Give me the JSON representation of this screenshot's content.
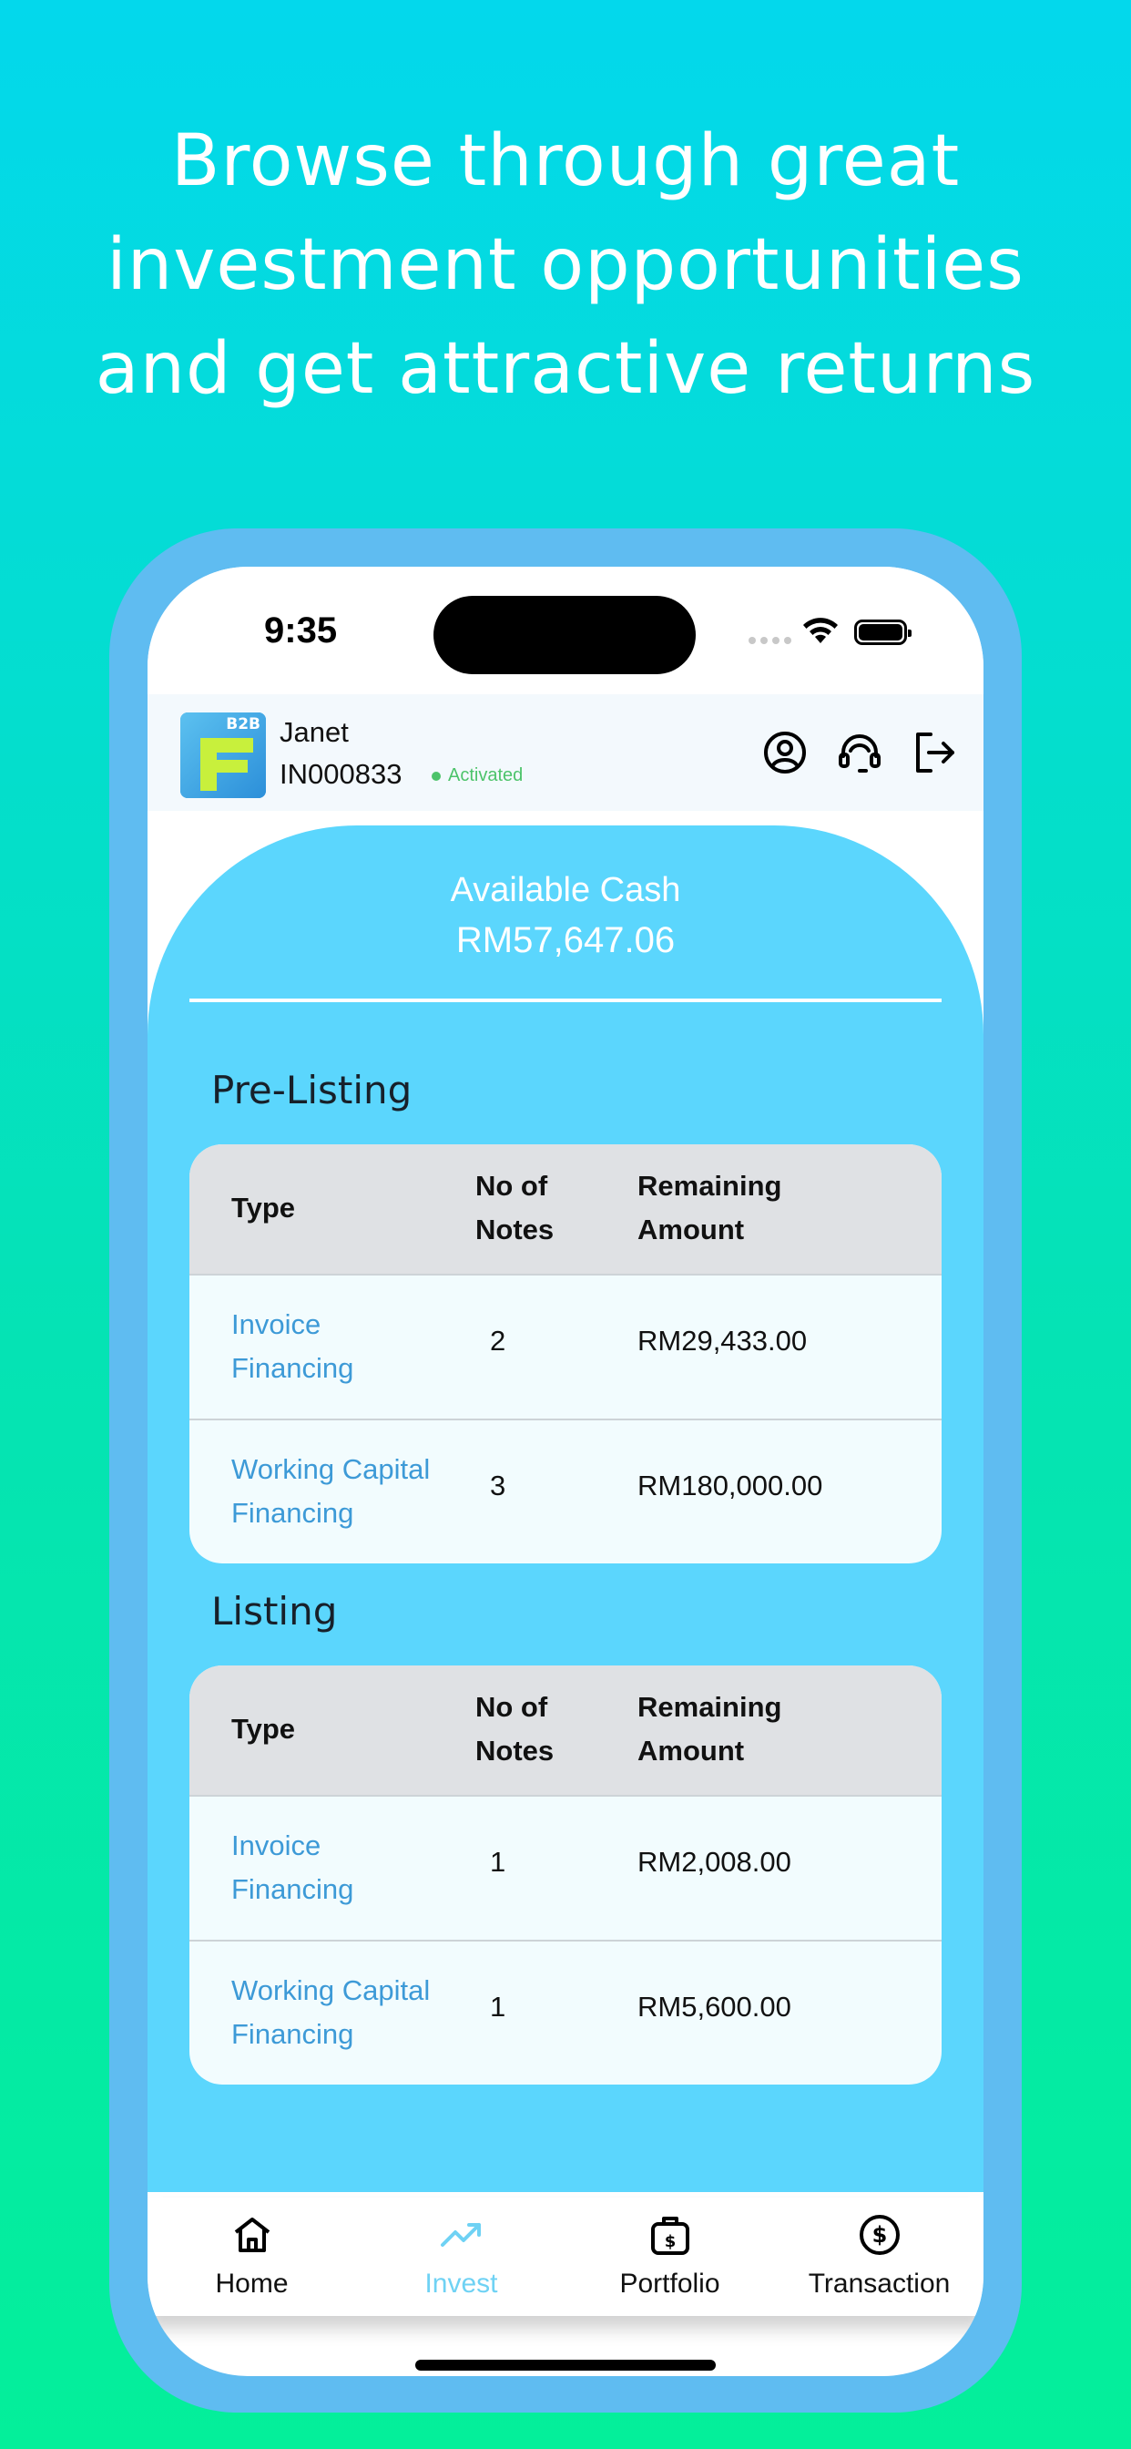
{
  "headline": {
    "line1": "Browse through great",
    "line2": "investment opportunities",
    "line3": "and get attractive returns"
  },
  "status_bar": {
    "time": "9:35"
  },
  "header": {
    "logo_text": "B2B",
    "user_name": "Janet",
    "user_id": "IN000833",
    "status": "Activated",
    "status_color": "#4cc36a"
  },
  "cash": {
    "label": "Available Cash",
    "value": "RM57,647.06"
  },
  "columns": {
    "type": "Type",
    "notes_line1": "No of",
    "notes_line2": "Notes",
    "amount_line1": "Remaining",
    "amount_line2": "Amount"
  },
  "pre_listing": {
    "title": "Pre-Listing",
    "rows": [
      {
        "type_line1": "Invoice",
        "type_line2": "Financing",
        "notes": "2",
        "amount": "RM29,433.00"
      },
      {
        "type_line1": "Working Capital",
        "type_line2": "Financing",
        "notes": "3",
        "amount": "RM180,000.00"
      }
    ]
  },
  "listing": {
    "title": "Listing",
    "rows": [
      {
        "type_line1": "Invoice",
        "type_line2": "Financing",
        "notes": "1",
        "amount": "RM2,008.00"
      },
      {
        "type_line1": "Working Capital",
        "type_line2": "Financing",
        "notes": "1",
        "amount": "RM5,600.00"
      }
    ]
  },
  "tabs": [
    {
      "label": "Home",
      "icon": "home-icon"
    },
    {
      "label": "Invest",
      "icon": "trending-up-icon",
      "active": true
    },
    {
      "label": "Portfolio",
      "icon": "briefcase-dollar-icon"
    },
    {
      "label": "Transaction",
      "icon": "dollar-circle-icon"
    }
  ],
  "colors": {
    "accent": "#5bd6fd",
    "link": "#3d9ad7",
    "active_tab": "#6fd2f4",
    "frame": "#5fbcf1"
  }
}
